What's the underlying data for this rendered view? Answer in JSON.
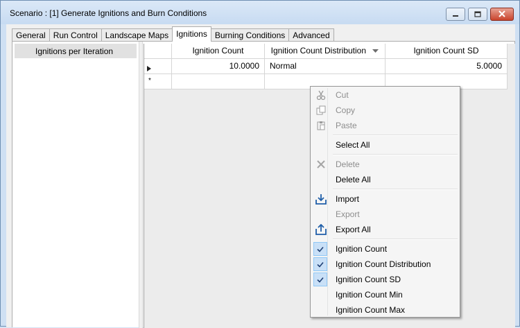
{
  "window": {
    "title": "Scenario : [1] Generate Ignitions and Burn Conditions"
  },
  "tabs": [
    "General",
    "Run Control",
    "Landscape Maps",
    "Ignitions",
    "Burning Conditions",
    "Advanced"
  ],
  "active_tab": "Ignitions",
  "left_panel": {
    "items": [
      "Ignitions per Iteration"
    ]
  },
  "grid": {
    "columns": [
      "Ignition Count",
      "Ignition Count Distribution",
      "Ignition Count SD"
    ],
    "rows": [
      {
        "ignition_count": "10.0000",
        "distribution": "Normal",
        "sd": "5.0000"
      }
    ],
    "new_row_marker": "*"
  },
  "context_menu": {
    "cut": "Cut",
    "copy": "Copy",
    "paste": "Paste",
    "select_all": "Select All",
    "delete": "Delete",
    "delete_all": "Delete All",
    "import": "Import",
    "export": "Export",
    "export_all": "Export All",
    "col_ignition_count": "Ignition Count",
    "col_distribution": "Ignition Count Distribution",
    "col_sd": "Ignition Count SD",
    "col_min": "Ignition Count Min",
    "col_max": "Ignition Count Max"
  },
  "colors": {
    "accent": "#1f5ea8",
    "check_bg": "#c9e0f7",
    "disabled_text": "#8d8d8d"
  }
}
